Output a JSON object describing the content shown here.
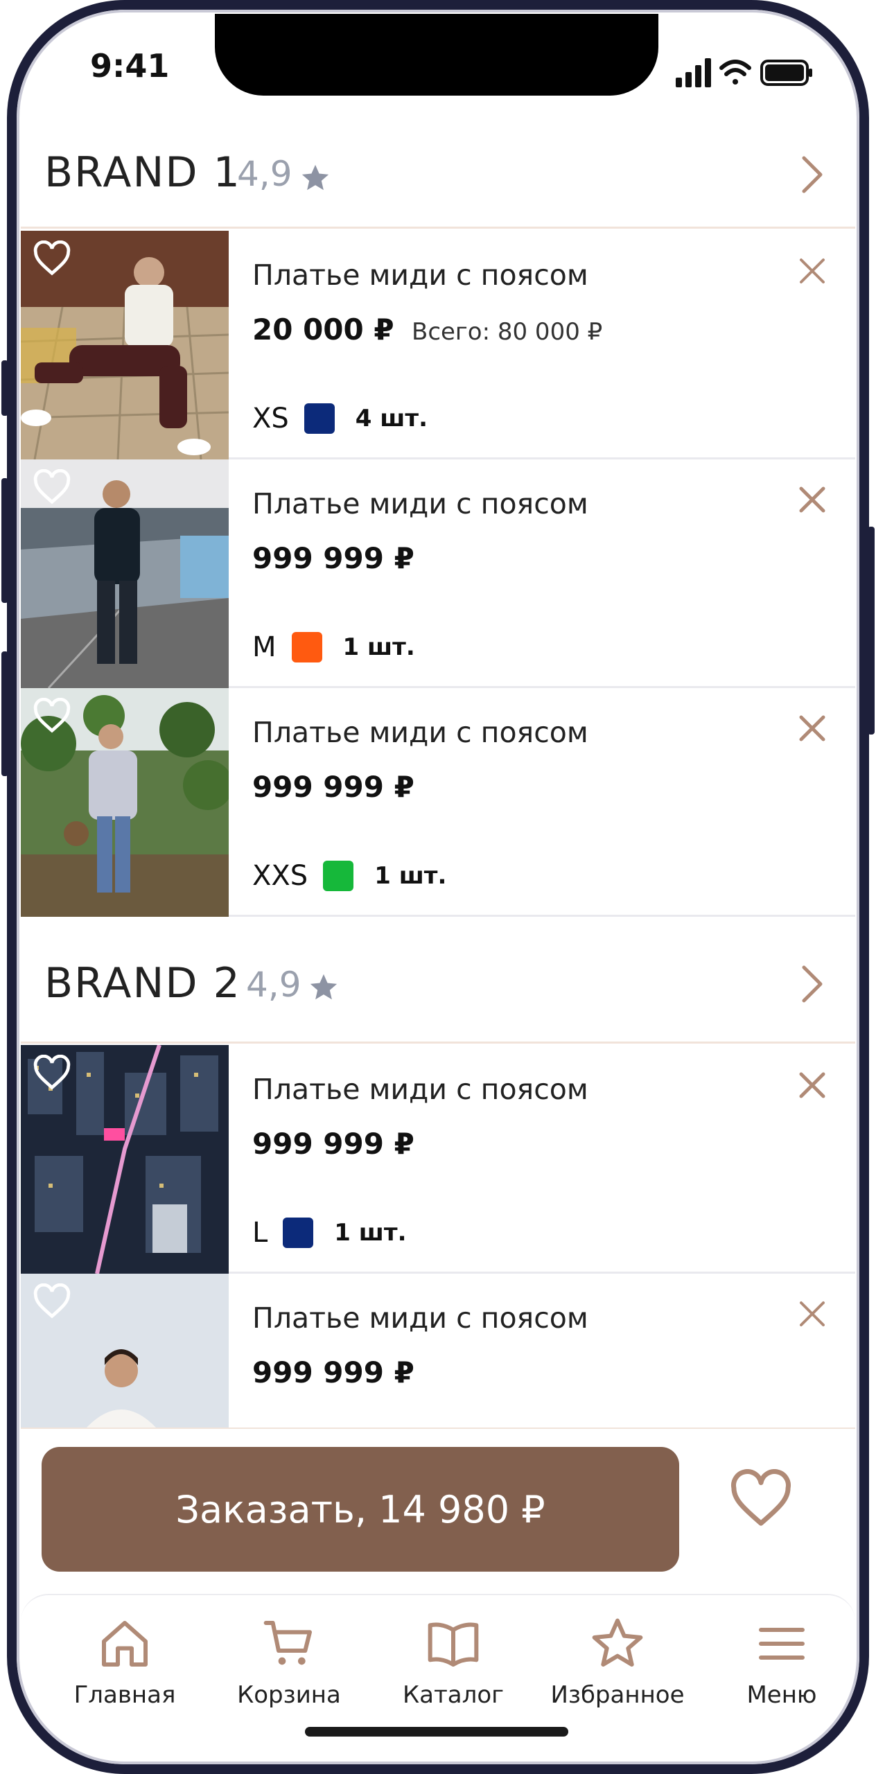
{
  "status": {
    "time": "9:41"
  },
  "brands": [
    {
      "name": "BRAND 1",
      "rating": "4,9"
    },
    {
      "name": "BRAND 2",
      "rating": "4,9"
    }
  ],
  "items": [
    {
      "title": "Платье миди с поясом",
      "price": "20 000 ₽",
      "total": "Всего: 80 000 ₽",
      "size": "XS",
      "color": "#0c2a7a",
      "qty": "4 шт."
    },
    {
      "title": "Платье миди с поясом",
      "price": "999 999 ₽",
      "total": "",
      "size": "M",
      "color": "#ff5a10",
      "qty": "1 шт."
    },
    {
      "title": "Платье миди с поясом",
      "price": "999 999 ₽",
      "total": "",
      "size": "XXS",
      "color": "#16b83a",
      "qty": "1 шт."
    },
    {
      "title": "Платье миди с поясом",
      "price": "999 999 ₽",
      "total": "",
      "size": "L",
      "color": "#0c2a7a",
      "qty": "1 шт."
    },
    {
      "title": "Платье миди с поясом",
      "price": "999 999 ₽",
      "total": "",
      "size": "",
      "color": "",
      "qty": ""
    }
  ],
  "order": {
    "label": "Заказать, 14 980 ₽"
  },
  "nav": [
    {
      "label": "Главная",
      "icon": "home-icon"
    },
    {
      "label": "Корзина",
      "icon": "cart-icon"
    },
    {
      "label": "Каталог",
      "icon": "book-icon"
    },
    {
      "label": "Избранное",
      "icon": "star-icon"
    },
    {
      "label": "Меню",
      "icon": "menu-icon"
    }
  ],
  "colors": {
    "accent": "#82604e",
    "icon": "#b08a76",
    "divider": "#f1e3da"
  }
}
